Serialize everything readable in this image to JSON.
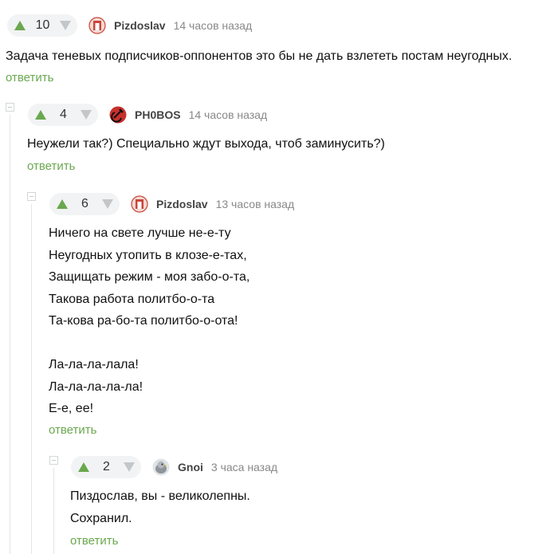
{
  "comments": [
    {
      "score": "10",
      "author": "Pizdoslav",
      "time": "14 часов назад",
      "avatar_icon": "pizdoslav-avatar-icon",
      "text": "Задача теневых подписчиков-оппонентов это бы не дать взлететь постам неугодных.",
      "reply": "ответить"
    },
    {
      "score": "4",
      "author": "PH0BOS",
      "time": "14 часов назад",
      "avatar_icon": "hammer-sickle-icon",
      "text": "Неужели так?) Специально ждут выхода, чтоб заминусить?)",
      "reply": "ответить"
    },
    {
      "score": "6",
      "author": "Pizdoslav",
      "time": "13 часов назад",
      "avatar_icon": "pizdoslav-avatar-icon",
      "text": "Ничего на свете лучше не-е-ту\nНеугодных утопить в клозе-е-тах,\nЗащищать режим - моя забо-о-та,\nТакова работа политбо-о-та\nТа-кова ра-бо-та политбо-о-ота!\n\nЛа-ла-ла-лала!\nЛа-ла-ла-ла-ла!\nЕ-е, ее!",
      "reply": "ответить"
    },
    {
      "score": "2",
      "author": "Gnoi",
      "time": "3 часа назад",
      "avatar_icon": "bird-avatar-icon",
      "text": "Пиздослав, вы - великолепны.\nСохранил.",
      "reply": "ответить"
    }
  ],
  "colors": {
    "accent": "#6aa84f",
    "muted": "#888888",
    "vote_down": "#c3c7ca"
  }
}
